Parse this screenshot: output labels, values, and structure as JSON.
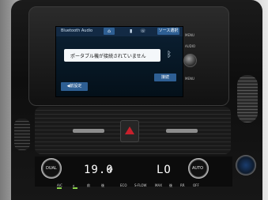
{
  "screen": {
    "source_title": "Bluetooth Audio",
    "source_button": "ソース選択",
    "message": "ポータブル機が接続されていません",
    "back_button": "◀前設定",
    "connect_button": "接続",
    "side_labels": [
      "MENU",
      "AUDIO",
      "MENU"
    ]
  },
  "climate": {
    "left_dial_label": "DUAL",
    "left_temp": "19.0",
    "right_temp": "LO",
    "right_dial_label": "AUTO",
    "fan_symbol": "✣",
    "buttons": [
      "A/C",
      "⌂",
      "前",
      "後",
      "ECO",
      "S-FLOW",
      "MAX",
      "後",
      "RR",
      "OFF"
    ]
  },
  "icons": [
    "home-icon",
    "battery-icon",
    "phone-icon",
    "bluetooth-icon",
    "hazard-icon",
    "fan-icon"
  ],
  "colors": {
    "screen_bg": "#0b2033",
    "button_blue": "#2e5f93",
    "hazard_red": "#c8202c",
    "indicator_green": "#8ad44a"
  }
}
